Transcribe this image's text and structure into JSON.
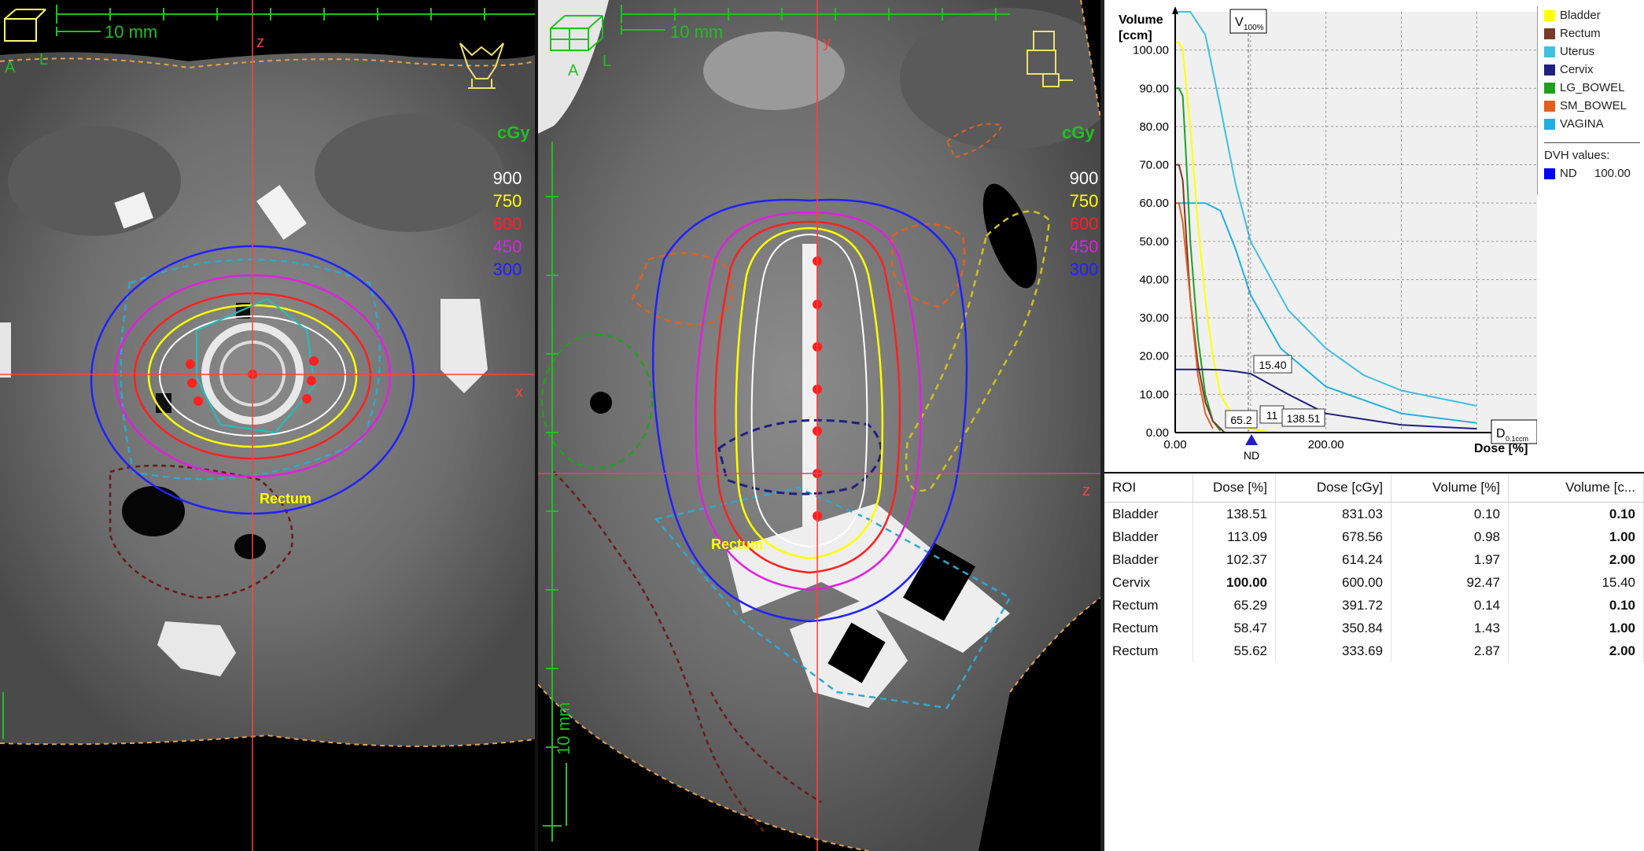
{
  "axial": {
    "scale_label": "10 mm",
    "axis_z": "z",
    "axis_x": "x",
    "orient_a": "A",
    "orient_l": "L",
    "roi_label": "Rectum",
    "dose_unit": "cGy",
    "isodose_levels": [
      {
        "value": "900",
        "color": "#ffffff"
      },
      {
        "value": "750",
        "color": "#ffff00"
      },
      {
        "value": "600",
        "color": "#ff2020"
      },
      {
        "value": "450",
        "color": "#e020e0"
      },
      {
        "value": "300",
        "color": "#2020ff"
      }
    ]
  },
  "sagittal": {
    "scale_label": "10 mm",
    "scale_label_vertical": "10 mm",
    "axis_y": "y",
    "axis_z": "z",
    "orient_a": "A",
    "orient_l": "L",
    "roi_label": "Rectum",
    "dose_unit": "cGy",
    "isodose_levels": [
      {
        "value": "900",
        "color": "#ffffff"
      },
      {
        "value": "750",
        "color": "#ffff00"
      },
      {
        "value": "600",
        "color": "#ff2020"
      },
      {
        "value": "450",
        "color": "#e020e0"
      },
      {
        "value": "300",
        "color": "#2020ff"
      }
    ]
  },
  "dvh": {
    "y_label_line1": "Volume",
    "y_label_line2": "[ccm]",
    "x_label": "Dose [%]",
    "v100_label": "V",
    "v100_sub": "100%",
    "d01_label": "D",
    "d01_sub": "0.1ccm",
    "nd_marker": "ND",
    "y_ticks": [
      "100.00",
      "90.00",
      "80.00",
      "70.00",
      "60.00",
      "50.00",
      "40.00",
      "30.00",
      "20.00",
      "10.00",
      "0.00"
    ],
    "x_ticks": [
      "0.00",
      "200.00"
    ],
    "callouts": [
      "15.40",
      "65.2",
      "11",
      "138.51"
    ],
    "legend": [
      {
        "name": "Bladder",
        "color": "#ffff00"
      },
      {
        "name": "Rectum",
        "color": "#7a3a2a"
      },
      {
        "name": "Uterus",
        "color": "#40c0e0"
      },
      {
        "name": "Cervix",
        "color": "#202080"
      },
      {
        "name": "LG_BOWEL",
        "color": "#20a020"
      },
      {
        "name": "SM_BOWEL",
        "color": "#e06020"
      },
      {
        "name": "VAGINA",
        "color": "#20b0e0"
      }
    ],
    "dvh_values_title": "DVH values:",
    "dvh_values": [
      {
        "name": "ND",
        "value": "100.00",
        "color": "#0000ff"
      }
    ]
  },
  "chart_data": {
    "type": "line",
    "title": "",
    "xlabel": "Dose [%]",
    "ylabel": "Volume [ccm]",
    "xlim": [
      0,
      480
    ],
    "ylim": [
      0,
      110
    ],
    "grid": true,
    "legend_placement": "right",
    "series": [
      {
        "name": "Uterus",
        "x": [
          0,
          20,
          40,
          60,
          80,
          100,
          150,
          200,
          250,
          300,
          400
        ],
        "y": [
          110,
          110,
          104,
          85,
          65,
          50,
          32,
          22,
          15,
          11,
          7
        ]
      },
      {
        "name": "VAGINA",
        "x": [
          0,
          20,
          40,
          60,
          80,
          100,
          140,
          200,
          300,
          400
        ],
        "y": [
          60,
          60,
          60,
          58,
          48,
          36,
          22,
          12,
          5,
          2.5
        ]
      },
      {
        "name": "Bladder",
        "x": [
          0,
          5,
          10,
          20,
          30,
          40,
          50,
          60,
          80,
          100,
          120,
          138
        ],
        "y": [
          102,
          102,
          100,
          80,
          55,
          35,
          20,
          10,
          3,
          1,
          0.3,
          0.1
        ]
      },
      {
        "name": "LG_BOWEL",
        "x": [
          0,
          5,
          10,
          15,
          20,
          30,
          40,
          50,
          60
        ],
        "y": [
          90,
          90,
          88,
          70,
          50,
          25,
          10,
          3,
          0.5
        ]
      },
      {
        "name": "Rectum",
        "x": [
          0,
          5,
          10,
          15,
          20,
          30,
          40,
          50,
          65
        ],
        "y": [
          70,
          70,
          66,
          50,
          35,
          18,
          8,
          3,
          0.1
        ]
      },
      {
        "name": "SM_BOWEL",
        "x": [
          0,
          5,
          10,
          20,
          30,
          40,
          50
        ],
        "y": [
          60,
          60,
          55,
          35,
          15,
          5,
          1
        ]
      },
      {
        "name": "Cervix",
        "x": [
          0,
          40,
          60,
          80,
          100,
          150,
          200,
          300,
          400
        ],
        "y": [
          16.5,
          16.5,
          16.4,
          16,
          15.4,
          10,
          5,
          2,
          1
        ]
      }
    ]
  },
  "roi_table": {
    "headers": [
      "ROI",
      "Dose [%]",
      "Dose [cGy]",
      "Volume [%]",
      "Volume [c..."
    ],
    "rows": [
      {
        "roi": "Bladder",
        "dose_pct": "138.51",
        "dose_cgy": "831.03",
        "vol_pct": "0.10",
        "vol_cc": "0.10",
        "bold_dose": false,
        "bold_vol": true
      },
      {
        "roi": "Bladder",
        "dose_pct": "113.09",
        "dose_cgy": "678.56",
        "vol_pct": "0.98",
        "vol_cc": "1.00",
        "bold_dose": false,
        "bold_vol": true
      },
      {
        "roi": "Bladder",
        "dose_pct": "102.37",
        "dose_cgy": "614.24",
        "vol_pct": "1.97",
        "vol_cc": "2.00",
        "bold_dose": false,
        "bold_vol": true
      },
      {
        "roi": "Cervix",
        "dose_pct": "100.00",
        "dose_cgy": "600.00",
        "vol_pct": "92.47",
        "vol_cc": "15.40",
        "bold_dose": true,
        "bold_vol": false
      },
      {
        "roi": "Rectum",
        "dose_pct": "65.29",
        "dose_cgy": "391.72",
        "vol_pct": "0.14",
        "vol_cc": "0.10",
        "bold_dose": false,
        "bold_vol": true
      },
      {
        "roi": "Rectum",
        "dose_pct": "58.47",
        "dose_cgy": "350.84",
        "vol_pct": "1.43",
        "vol_cc": "1.00",
        "bold_dose": false,
        "bold_vol": true
      },
      {
        "roi": "Rectum",
        "dose_pct": "55.62",
        "dose_cgy": "333.69",
        "vol_pct": "2.87",
        "vol_cc": "2.00",
        "bold_dose": false,
        "bold_vol": true
      }
    ]
  }
}
